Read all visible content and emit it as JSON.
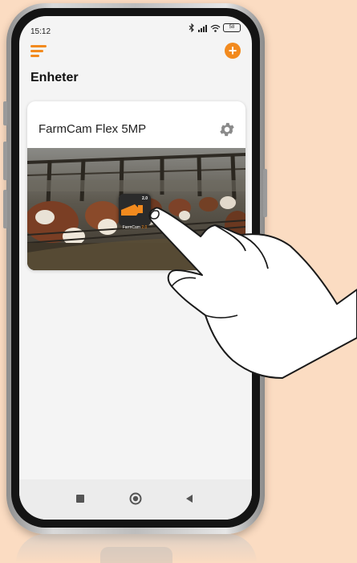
{
  "status_bar": {
    "time": "15:12",
    "bluetooth_icon": "bluetooth-icon",
    "signal_icon": "signal-icon",
    "wifi_icon": "wifi-icon",
    "battery_level": "58"
  },
  "app_bar": {
    "menu_icon": "menu-icon",
    "add_icon": "plus-circle-icon",
    "accent_color": "#f28a1e"
  },
  "page": {
    "title": "Enheter"
  },
  "devices": [
    {
      "name": "FarmCam Flex 5MP",
      "settings_icon": "gear-icon",
      "thumbnail": "cow-barn-camera-view",
      "app_logo": {
        "label_main": "FarmCam",
        "label_version": "2.0",
        "badge_version": "2.0"
      }
    }
  ],
  "nav_bar": {
    "recents_icon": "square-icon",
    "home_icon": "circle-icon",
    "back_icon": "back-triangle-icon"
  },
  "colors": {
    "background": "#fbdcc2",
    "accent": "#f28a1e"
  }
}
